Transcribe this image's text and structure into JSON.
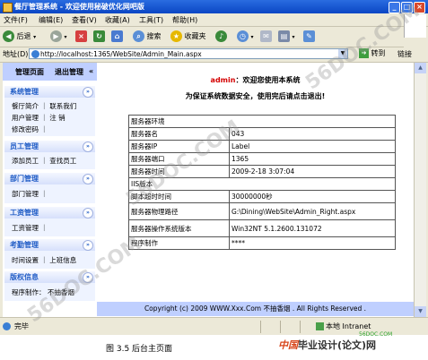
{
  "window": {
    "title": "餐厅管理系统 - 欢迎使用秘破优化网吧版",
    "buttons": [
      "_",
      "□",
      "×"
    ]
  },
  "menubar": [
    "文件(F)",
    "编辑(E)",
    "查看(V)",
    "收藏(A)",
    "工具(T)",
    "帮助(H)"
  ],
  "toolbar": {
    "back_label": "后退",
    "search_label": "搜索",
    "favorites_label": "收藏夹"
  },
  "address": {
    "label": "地址(D)",
    "url": "http://localhost:1365/WebSite/Admin_Main.aspx",
    "go_label": "转到",
    "links_label": "链接"
  },
  "sidebar": {
    "header_tabs": [
      "管理页面",
      "退出管理"
    ],
    "header_arrow": "«",
    "sections": [
      {
        "title": "系统管理",
        "lines": [
          "餐厅简介 ｜ 联系我们",
          "用户管理 ｜ 注 销",
          "修改密码 ｜"
        ]
      },
      {
        "title": "员工管理",
        "lines": [
          "添加员工 ｜ 查找员工"
        ]
      },
      {
        "title": "部门管理",
        "lines": [
          "部门管理 ｜"
        ]
      },
      {
        "title": "工资管理",
        "lines": [
          "工资管理 ｜"
        ]
      },
      {
        "title": "考勤管理",
        "lines": [
          "时间设置 ｜ 上班信息"
        ]
      },
      {
        "title": "版权信息",
        "lines": [
          "程序制作： 不抽香烟"
        ]
      }
    ],
    "chevron": "»"
  },
  "main": {
    "welcome_user": "admin",
    "welcome_suffix": "：欢迎您使用本系统",
    "security_tip": "为保证系统数据安全，使用完后请点击退出!",
    "info_rows": [
      {
        "label": "服务器环境",
        "value": ""
      },
      {
        "label": "服务器名",
        "value": "043"
      },
      {
        "label": "服务器IP",
        "value": "Label"
      },
      {
        "label": "服务器端口",
        "value": "1365"
      },
      {
        "label": "服务器时间",
        "value": "2009-2-18 3:07:04"
      },
      {
        "label": "IIS版本",
        "value": ""
      },
      {
        "label": "脚本超时时间",
        "value": "30000000秒"
      },
      {
        "label": "服务器物理路径",
        "value": "G:\\Dining\\WebSite\\Admin_Right.aspx"
      },
      {
        "label": "服务器操作系统版本",
        "value": "Win32NT 5.1.2600.131072"
      },
      {
        "label": "程序制作",
        "value": "****"
      }
    ],
    "footer": "Copyright (c) 2009   WWW.Xxx.Com 不抽香烟  . All Rights Reserved ."
  },
  "statusbar": {
    "left": "完毕",
    "zone": "本地 Intranet"
  },
  "caption": "图 3.5  后台主页面",
  "watermark": {
    "brand_prefix": "中国",
    "brand_suffix": "毕业设计(论文)网",
    "small": "56DOC.COM",
    "diag": "56DOC.COM"
  },
  "colors": {
    "titlebar": "#0a46c4",
    "sidebar_header": "#bfcfff",
    "section_title": "#215dc6",
    "admin_red": "#d40000"
  }
}
